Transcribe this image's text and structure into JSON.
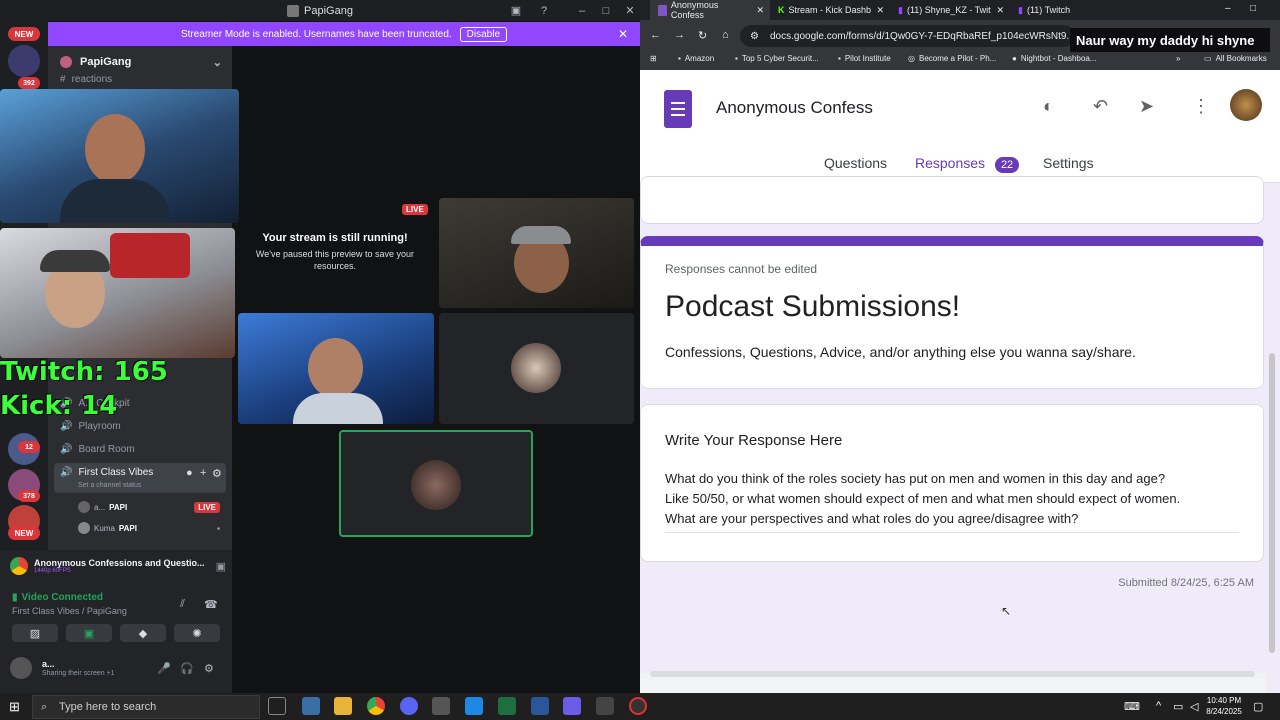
{
  "discord": {
    "title": "PapiGang",
    "banner_text": "Streamer Mode is enabled. Usernames have been truncated.",
    "banner_button": "Disable",
    "server_name": "PapiGang",
    "channel_top": "reactions",
    "server_badges": {
      "new": "NEW",
      "c1": "392",
      "c2": "12",
      "c3": "378",
      "new2": "NEW"
    },
    "channels": [
      "A... Cockpit",
      "Playroom",
      "Board Room"
    ],
    "active_channel": "First Class Vibes",
    "channel_status": "Set a channel status",
    "members": [
      {
        "name": "a...",
        "tag": "PAPI",
        "live": "LIVE"
      },
      {
        "name": "Kuma",
        "tag": "PAPI"
      }
    ],
    "activity_title": "Anonymous Confessions and Questio...",
    "activity_sub": "1440p 60FPS",
    "video_status": "Video Connected",
    "voice_location": "First Class Vibes / PapiGang",
    "user_name": "a...",
    "user_status": "Sharing their screen +1",
    "stream_paused_title": "Your stream is still running!",
    "stream_paused_body": "We've paused this preview to save your resources.",
    "live_badge": "LIVE"
  },
  "overlay": {
    "twitch_label": "Twitch: 165",
    "kick_label": "Kick: 14",
    "chat_message": "Naur way my daddy hi shyne"
  },
  "chrome": {
    "tabs": [
      "Anonymous Confess",
      "Stream - Kick Dashb",
      "(11) Shyne_KZ - Twit",
      "(11) Twitch"
    ],
    "url": "docs.google.com/forms/d/1Qw0GY-7-EDqRbaREf_p104ecWRsNt9...",
    "bookmarks": [
      "Amazon",
      "Top 5 Cyber Securit...",
      "Pilot Institute",
      "Become a Pilot - Ph...",
      "Nightbot - Dashboa..."
    ],
    "all_bookmarks": "All Bookmarks"
  },
  "form": {
    "title": "Anonymous Confess",
    "tabs": {
      "questions": "Questions",
      "responses": "Responses",
      "responses_count": "22",
      "settings": "Settings"
    },
    "notice": "Responses cannot be edited",
    "heading": "Podcast Submissions!",
    "description": "Confessions, Questions, Advice, and/or anything else you wanna say/share.",
    "question_title": "Write Your Response Here",
    "answer_lines": [
      "What do you think of the roles society has put on men and women in this day and age?",
      "Like 50/50, or what women should expect of men and what men should expect of women.",
      "What are your perspectives and what roles do you agree/disagree with?"
    ],
    "submitted": "Submitted 8/24/25, 6:25 AM",
    "accent": "#673ab7"
  },
  "taskbar": {
    "search_placeholder": "Type here to search",
    "time": "10:40 PM",
    "date": "8/24/2025"
  }
}
